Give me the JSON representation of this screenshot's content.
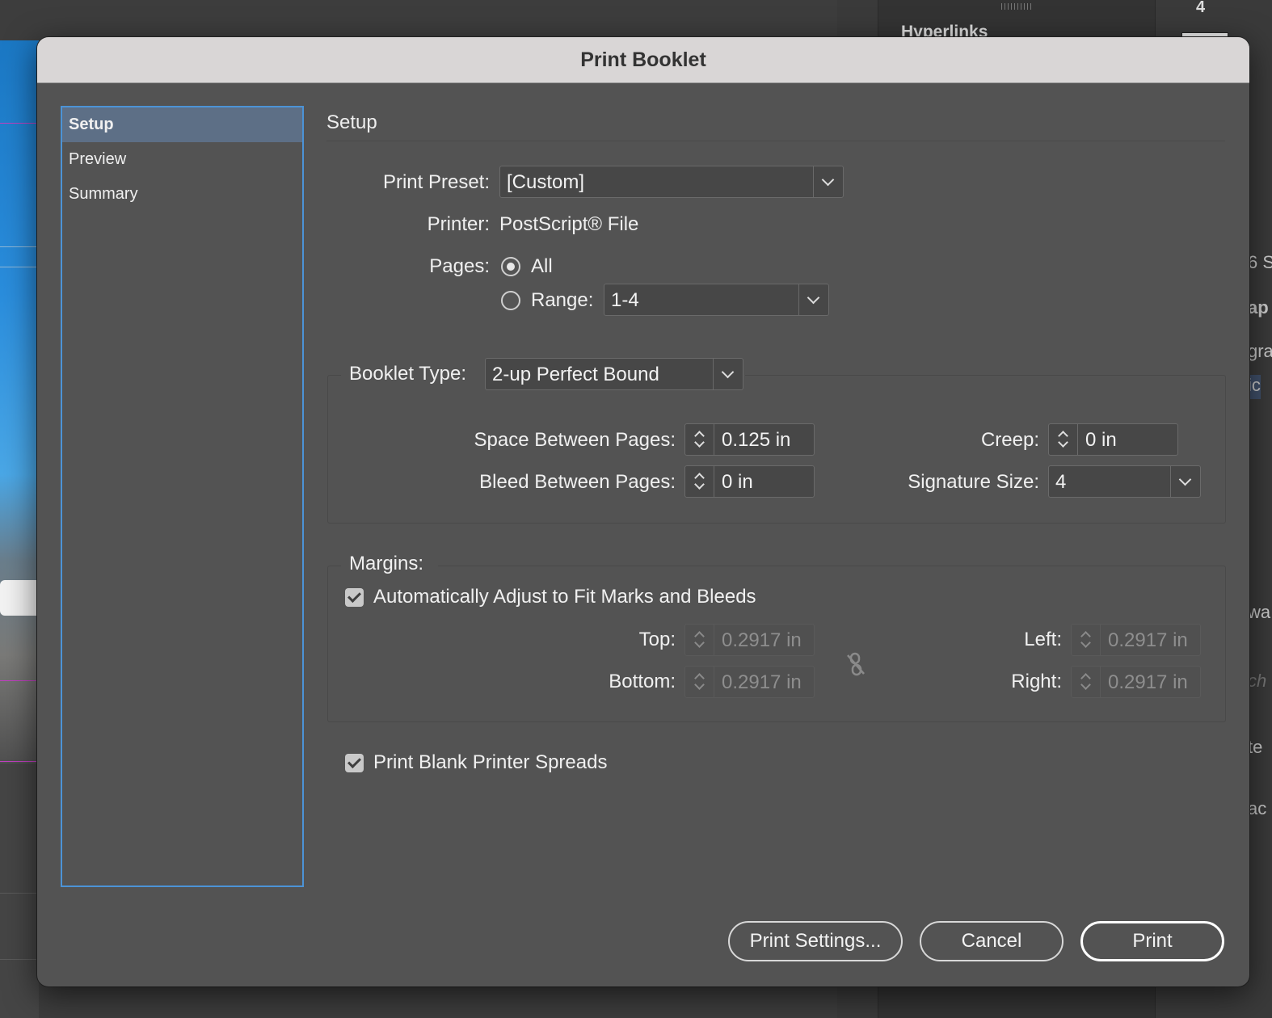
{
  "background": {
    "panel_title": "Hyperlinks",
    "panel_number": "4",
    "fragments": [
      "6 S",
      "ap",
      "gra",
      "ic",
      "wa",
      "ch",
      "te",
      "ac"
    ]
  },
  "dialog": {
    "title": "Print Booklet",
    "nav": [
      {
        "label": "Setup",
        "active": true
      },
      {
        "label": "Preview",
        "active": false
      },
      {
        "label": "Summary",
        "active": false
      }
    ],
    "section_title": "Setup",
    "print_preset": {
      "label": "Print Preset:",
      "value": "[Custom]"
    },
    "printer": {
      "label": "Printer:",
      "value": "PostScript® File"
    },
    "pages": {
      "label": "Pages:",
      "all_label": "All",
      "range_label": "Range:",
      "range_value": "1-4",
      "selected": "All"
    },
    "booklet_type": {
      "label": "Booklet Type:",
      "value": "2-up Perfect Bound"
    },
    "space_between_pages": {
      "label": "Space Between Pages:",
      "value": "0.125 in"
    },
    "bleed_between_pages": {
      "label": "Bleed Between Pages:",
      "value": "0 in"
    },
    "creep": {
      "label": "Creep:",
      "value": "0 in"
    },
    "signature_size": {
      "label": "Signature Size:",
      "value": "4"
    },
    "margins": {
      "label": "Margins:",
      "auto_adjust_label": "Automatically Adjust to Fit Marks and Bleeds",
      "auto_adjust_checked": true,
      "top": {
        "label": "Top:",
        "value": "0.2917 in"
      },
      "bottom": {
        "label": "Bottom:",
        "value": "0.2917 in"
      },
      "left": {
        "label": "Left:",
        "value": "0.2917 in"
      },
      "right": {
        "label": "Right:",
        "value": "0.2917 in"
      }
    },
    "print_blank_spreads": {
      "label": "Print Blank Printer Spreads",
      "checked": true
    },
    "buttons": {
      "print_settings": "Print Settings...",
      "cancel": "Cancel",
      "print": "Print"
    }
  }
}
